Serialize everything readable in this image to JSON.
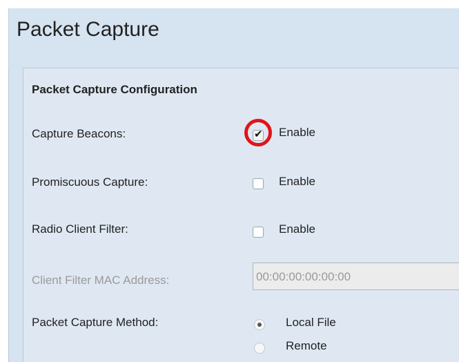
{
  "page": {
    "title": "Packet Capture"
  },
  "section": {
    "title": "Packet Capture Configuration"
  },
  "fields": {
    "capture_beacons": {
      "label": "Capture Beacons:",
      "option": "Enable",
      "checked": true
    },
    "promiscuous_capture": {
      "label": "Promiscuous Capture:",
      "option": "Enable",
      "checked": false
    },
    "radio_client_filter": {
      "label": "Radio Client Filter:",
      "option": "Enable",
      "checked": false
    },
    "client_filter_mac": {
      "label": "Client Filter MAC Address:",
      "value": "00:00:00:00:00:00",
      "disabled": true
    },
    "capture_method": {
      "label": "Packet Capture Method:",
      "options": [
        "Local File",
        "Remote"
      ],
      "selected": "Local File"
    }
  },
  "colors": {
    "panel_bg": "#dfe8f2",
    "header_bg": "#d6e3f0",
    "highlight": "#e0141b"
  }
}
